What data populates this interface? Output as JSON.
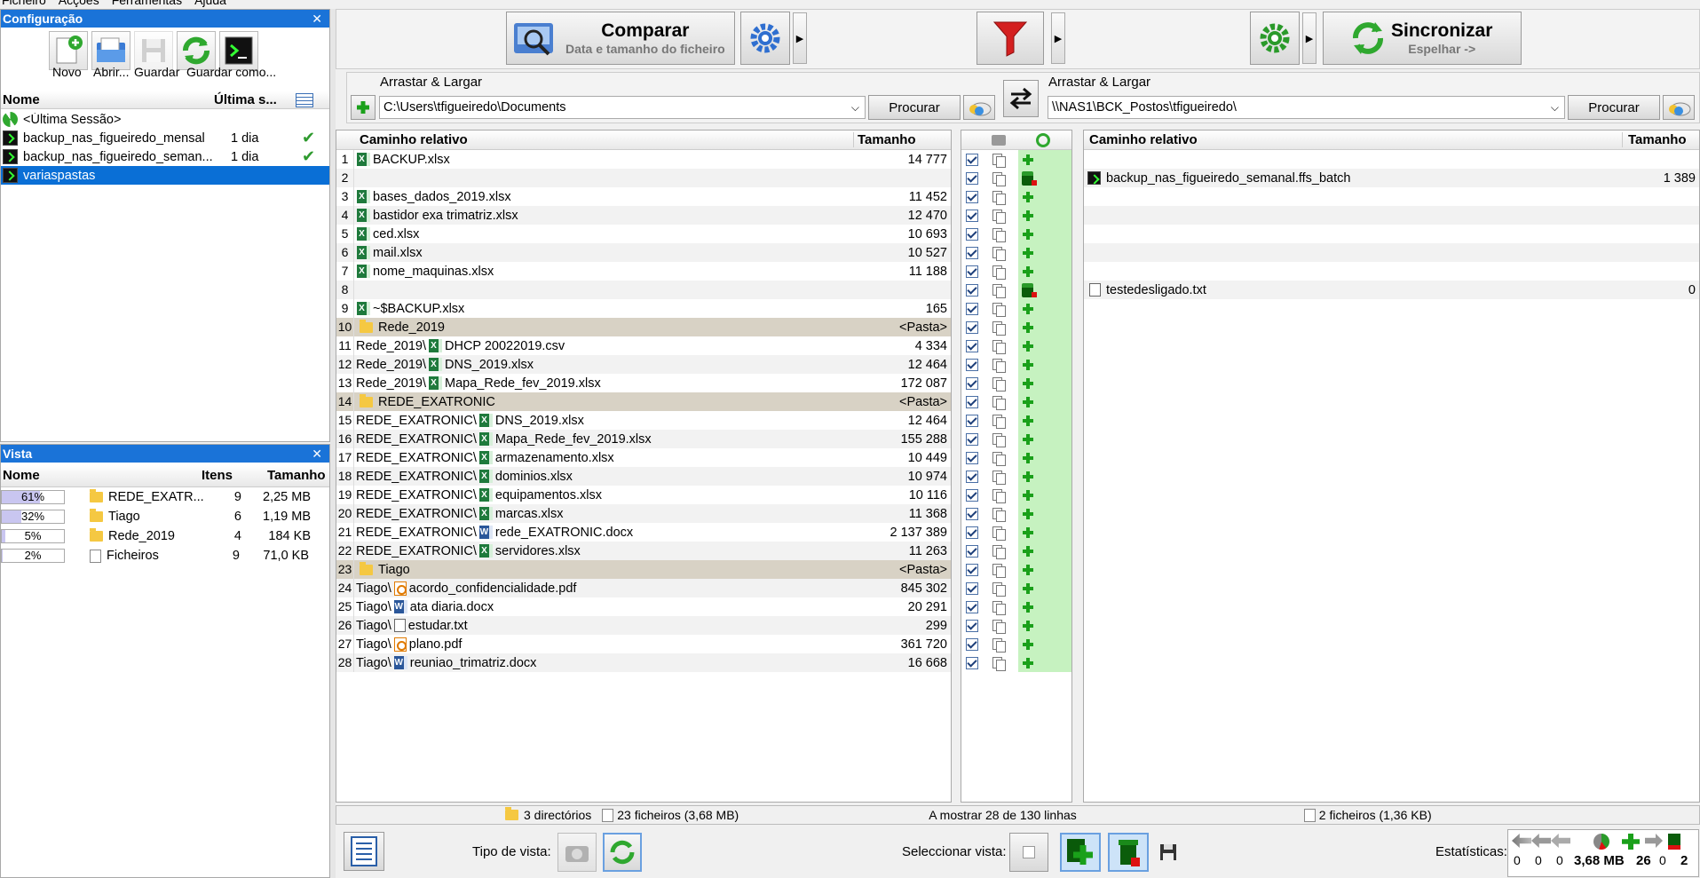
{
  "menu": [
    "Ficheiro",
    "Acções",
    "Ferramentas",
    "Ajuda"
  ],
  "config": {
    "title": "Configuração",
    "buttons": [
      "Novo",
      "Abrir...",
      "Guardar",
      "Guardar como..."
    ],
    "col_name": "Nome",
    "col_last": "Última s...",
    "items": [
      {
        "name": "<Última Sessão>",
        "last": "",
        "ok": false,
        "icon": "session-icon"
      },
      {
        "name": "backup_nas_figueiredo_mensal",
        "last": "1 dia",
        "ok": true,
        "icon": "batch-icon"
      },
      {
        "name": "backup_nas_figueiredo_seman...",
        "last": "1 dia",
        "ok": true,
        "icon": "batch-icon"
      },
      {
        "name": "variaspastas",
        "last": "",
        "ok": false,
        "icon": "batch-icon",
        "selected": true
      }
    ]
  },
  "vista": {
    "title": "Vista",
    "col_name": "Nome",
    "col_items": "Itens",
    "col_size": "Tamanho",
    "rows": [
      {
        "pct": "61%",
        "frac": 0.61,
        "name": "REDE_EXATR...",
        "items": "9",
        "size": "2,25 MB",
        "folder": true
      },
      {
        "pct": "32%",
        "frac": 0.32,
        "name": "Tiago",
        "items": "6",
        "size": "1,19 MB",
        "folder": true
      },
      {
        "pct": "5%",
        "frac": 0.05,
        "name": "Rede_2019",
        "items": "4",
        "size": "184 KB",
        "folder": true
      },
      {
        "pct": "2%",
        "frac": 0.02,
        "name": "Ficheiros",
        "items": "9",
        "size": "71,0 KB",
        "folder": false
      }
    ]
  },
  "toolbar": {
    "compare_title": "Comparar",
    "compare_sub": "Data e tamanho do ficheiro",
    "sync_title": "Sincronizar",
    "sync_sub": "Espelhar ->"
  },
  "left": {
    "drag_label": "Arrastar & Largar",
    "path": "C:\\Users\\tfigueiredo\\Documents",
    "browse": "Procurar",
    "col_path": "Caminho relativo",
    "col_size": "Tamanho",
    "rows": [
      {
        "n": "1",
        "pre": "",
        "icon": "xls",
        "name": "BACKUP.xlsx",
        "size": "14 777"
      },
      {
        "n": "2",
        "pre": "",
        "icon": "",
        "name": "",
        "size": ""
      },
      {
        "n": "3",
        "pre": "",
        "icon": "xls",
        "name": "bases_dados_2019.xlsx",
        "size": "11 452"
      },
      {
        "n": "4",
        "pre": "",
        "icon": "xls",
        "name": "bastidor exa trimatriz.xlsx",
        "size": "12 470"
      },
      {
        "n": "5",
        "pre": "",
        "icon": "xls",
        "name": "ced.xlsx",
        "size": "10 693"
      },
      {
        "n": "6",
        "pre": "",
        "icon": "xls",
        "name": "mail.xlsx",
        "size": "10 527"
      },
      {
        "n": "7",
        "pre": "",
        "icon": "xls",
        "name": "nome_maquinas.xlsx",
        "size": "11 188"
      },
      {
        "n": "8",
        "pre": "",
        "icon": "",
        "name": "",
        "size": ""
      },
      {
        "n": "9",
        "pre": "",
        "icon": "xls",
        "name": "~$BACKUP.xlsx",
        "size": "165"
      },
      {
        "n": "10",
        "pre": "",
        "icon": "folder",
        "name": "Rede_2019",
        "size": "<Pasta>"
      },
      {
        "n": "11",
        "pre": "Rede_2019\\",
        "icon": "xls",
        "name": "DHCP 20022019.csv",
        "size": "4 334"
      },
      {
        "n": "12",
        "pre": "Rede_2019\\",
        "icon": "xls",
        "name": "DNS_2019.xlsx",
        "size": "12 464"
      },
      {
        "n": "13",
        "pre": "Rede_2019\\",
        "icon": "xls",
        "name": "Mapa_Rede_fev_2019.xlsx",
        "size": "172 087"
      },
      {
        "n": "14",
        "pre": "",
        "icon": "folder",
        "name": "REDE_EXATRONIC",
        "size": "<Pasta>"
      },
      {
        "n": "15",
        "pre": "REDE_EXATRONIC\\",
        "icon": "xls",
        "name": "DNS_2019.xlsx",
        "size": "12 464"
      },
      {
        "n": "16",
        "pre": "REDE_EXATRONIC\\",
        "icon": "xls",
        "name": "Mapa_Rede_fev_2019.xlsx",
        "size": "155 288"
      },
      {
        "n": "17",
        "pre": "REDE_EXATRONIC\\",
        "icon": "xls",
        "name": "armazenamento.xlsx",
        "size": "10 449"
      },
      {
        "n": "18",
        "pre": "REDE_EXATRONIC\\",
        "icon": "xls",
        "name": "dominios.xlsx",
        "size": "10 974"
      },
      {
        "n": "19",
        "pre": "REDE_EXATRONIC\\",
        "icon": "xls",
        "name": "equipamentos.xlsx",
        "size": "10 116"
      },
      {
        "n": "20",
        "pre": "REDE_EXATRONIC\\",
        "icon": "xls",
        "name": "marcas.xlsx",
        "size": "11 368"
      },
      {
        "n": "21",
        "pre": "REDE_EXATRONIC\\",
        "icon": "docx",
        "name": "rede_EXATRONIC.docx",
        "size": "2 137 389"
      },
      {
        "n": "22",
        "pre": "REDE_EXATRONIC\\",
        "icon": "xls",
        "name": "servidores.xlsx",
        "size": "11 263"
      },
      {
        "n": "23",
        "pre": "",
        "icon": "folder",
        "name": "Tiago",
        "size": "<Pasta>"
      },
      {
        "n": "24",
        "pre": "Tiago\\",
        "icon": "pdf",
        "name": "acordo_confidencialidade.pdf",
        "size": "845 302"
      },
      {
        "n": "25",
        "pre": "Tiago\\",
        "icon": "docx",
        "name": "ata diaria.docx",
        "size": "20 291"
      },
      {
        "n": "26",
        "pre": "Tiago\\",
        "icon": "txt",
        "name": "estudar.txt",
        "size": "299"
      },
      {
        "n": "27",
        "pre": "Tiago\\",
        "icon": "pdf",
        "name": "plano.pdf",
        "size": "361 720"
      },
      {
        "n": "28",
        "pre": "Tiago\\",
        "icon": "docx",
        "name": "reuniao_trimatriz.docx",
        "size": "16 668"
      }
    ]
  },
  "middle": {
    "actions": [
      "plus",
      "del",
      "plus",
      "plus",
      "plus",
      "plus",
      "plus",
      "del",
      "plus",
      "plus",
      "plus",
      "plus",
      "plus",
      "plus",
      "plus",
      "plus",
      "plus",
      "plus",
      "plus",
      "plus",
      "plus",
      "plus",
      "plus",
      "plus",
      "plus",
      "plus",
      "plus",
      "plus"
    ]
  },
  "right": {
    "drag_label": "Arrastar & Largar",
    "path": "\\\\NAS1\\BCK_Postos\\tfigueiredo\\",
    "browse": "Procurar",
    "col_path": "Caminho relativo",
    "col_size": "Tamanho",
    "rows": [
      {
        "icon": "",
        "name": "",
        "size": ""
      },
      {
        "icon": "batch",
        "name": "backup_nas_figueiredo_semanal.ffs_batch",
        "size": "1 389"
      },
      {
        "icon": "",
        "name": "",
        "size": ""
      },
      {
        "icon": "",
        "name": "",
        "size": ""
      },
      {
        "icon": "",
        "name": "",
        "size": ""
      },
      {
        "icon": "",
        "name": "",
        "size": ""
      },
      {
        "icon": "",
        "name": "",
        "size": ""
      },
      {
        "icon": "txt",
        "name": "testedesligado.txt",
        "size": "0"
      }
    ]
  },
  "status": {
    "dirs": "3 directórios",
    "files": "23 ficheiros (3,68 MB)",
    "showing": "A mostrar 28 de 130 linhas",
    "right_files": "2 ficheiros (1,36 KB)"
  },
  "bottom": {
    "view_type": "Tipo de vista:",
    "select_view": "Seleccionar vista:",
    "stats_label": "Estatísticas:",
    "stats": [
      "0",
      "0",
      "0",
      "3,68 MB",
      "26",
      "0",
      "2"
    ]
  }
}
